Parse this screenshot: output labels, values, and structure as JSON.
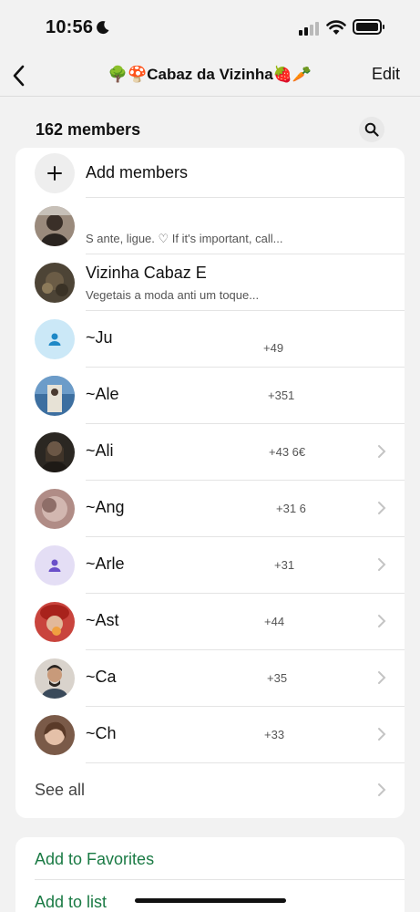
{
  "status_bar": {
    "time": "10:56",
    "icons": [
      "moon-icon",
      "signal-icon",
      "wifi-icon",
      "battery-icon"
    ]
  },
  "nav": {
    "title": "🌳🍄Cabaz da Vizinha🍓🥕",
    "edit_label": "Edit",
    "back_icon": "chevron-left-icon"
  },
  "members": {
    "count_label": "162 members",
    "search_icon": "search-icon",
    "add_label": "Add members",
    "list": [
      {
        "name": "",
        "subtitle": "S ante, ligue. ♡ If it's important, call...",
        "phone": "",
        "avatar_color": "#9a8a7c"
      },
      {
        "name": "Vizinha Cabaz E",
        "subtitle": "Vegetais a moda anti um toque...",
        "phone": "",
        "avatar_color": "#4d4436"
      },
      {
        "name": "~Ju",
        "subtitle": "",
        "phone": "+49",
        "avatar_color": "#cbe8f7"
      },
      {
        "name": "~Ale",
        "subtitle": "",
        "phone": "+351",
        "avatar_color": "#3d6fa0"
      },
      {
        "name": "~Ali",
        "subtitle": "",
        "phone": "+43 6€",
        "avatar_color": "#2b2722"
      },
      {
        "name": "~Ang",
        "subtitle": "",
        "phone": "+31 6",
        "avatar_color": "#b08c86"
      },
      {
        "name": "~Arle",
        "subtitle": "",
        "phone": "+31",
        "avatar_color": "#e4def5"
      },
      {
        "name": "~Ast",
        "subtitle": "",
        "phone": "+44",
        "avatar_color": "#c9443d"
      },
      {
        "name": "~Ca",
        "subtitle": "",
        "phone": "+35",
        "avatar_color": "#d9d3cc"
      },
      {
        "name": "~Ch",
        "subtitle": "",
        "phone": "+33",
        "avatar_color": "#7a5a48"
      }
    ],
    "see_all_label": "See all"
  },
  "actions": {
    "add_to_favorites": "Add to Favorites",
    "add_to_list": "Add to list"
  },
  "colors": {
    "accent_green": "#1a7a44",
    "background": "#f2f2f2",
    "card": "#ffffff"
  }
}
